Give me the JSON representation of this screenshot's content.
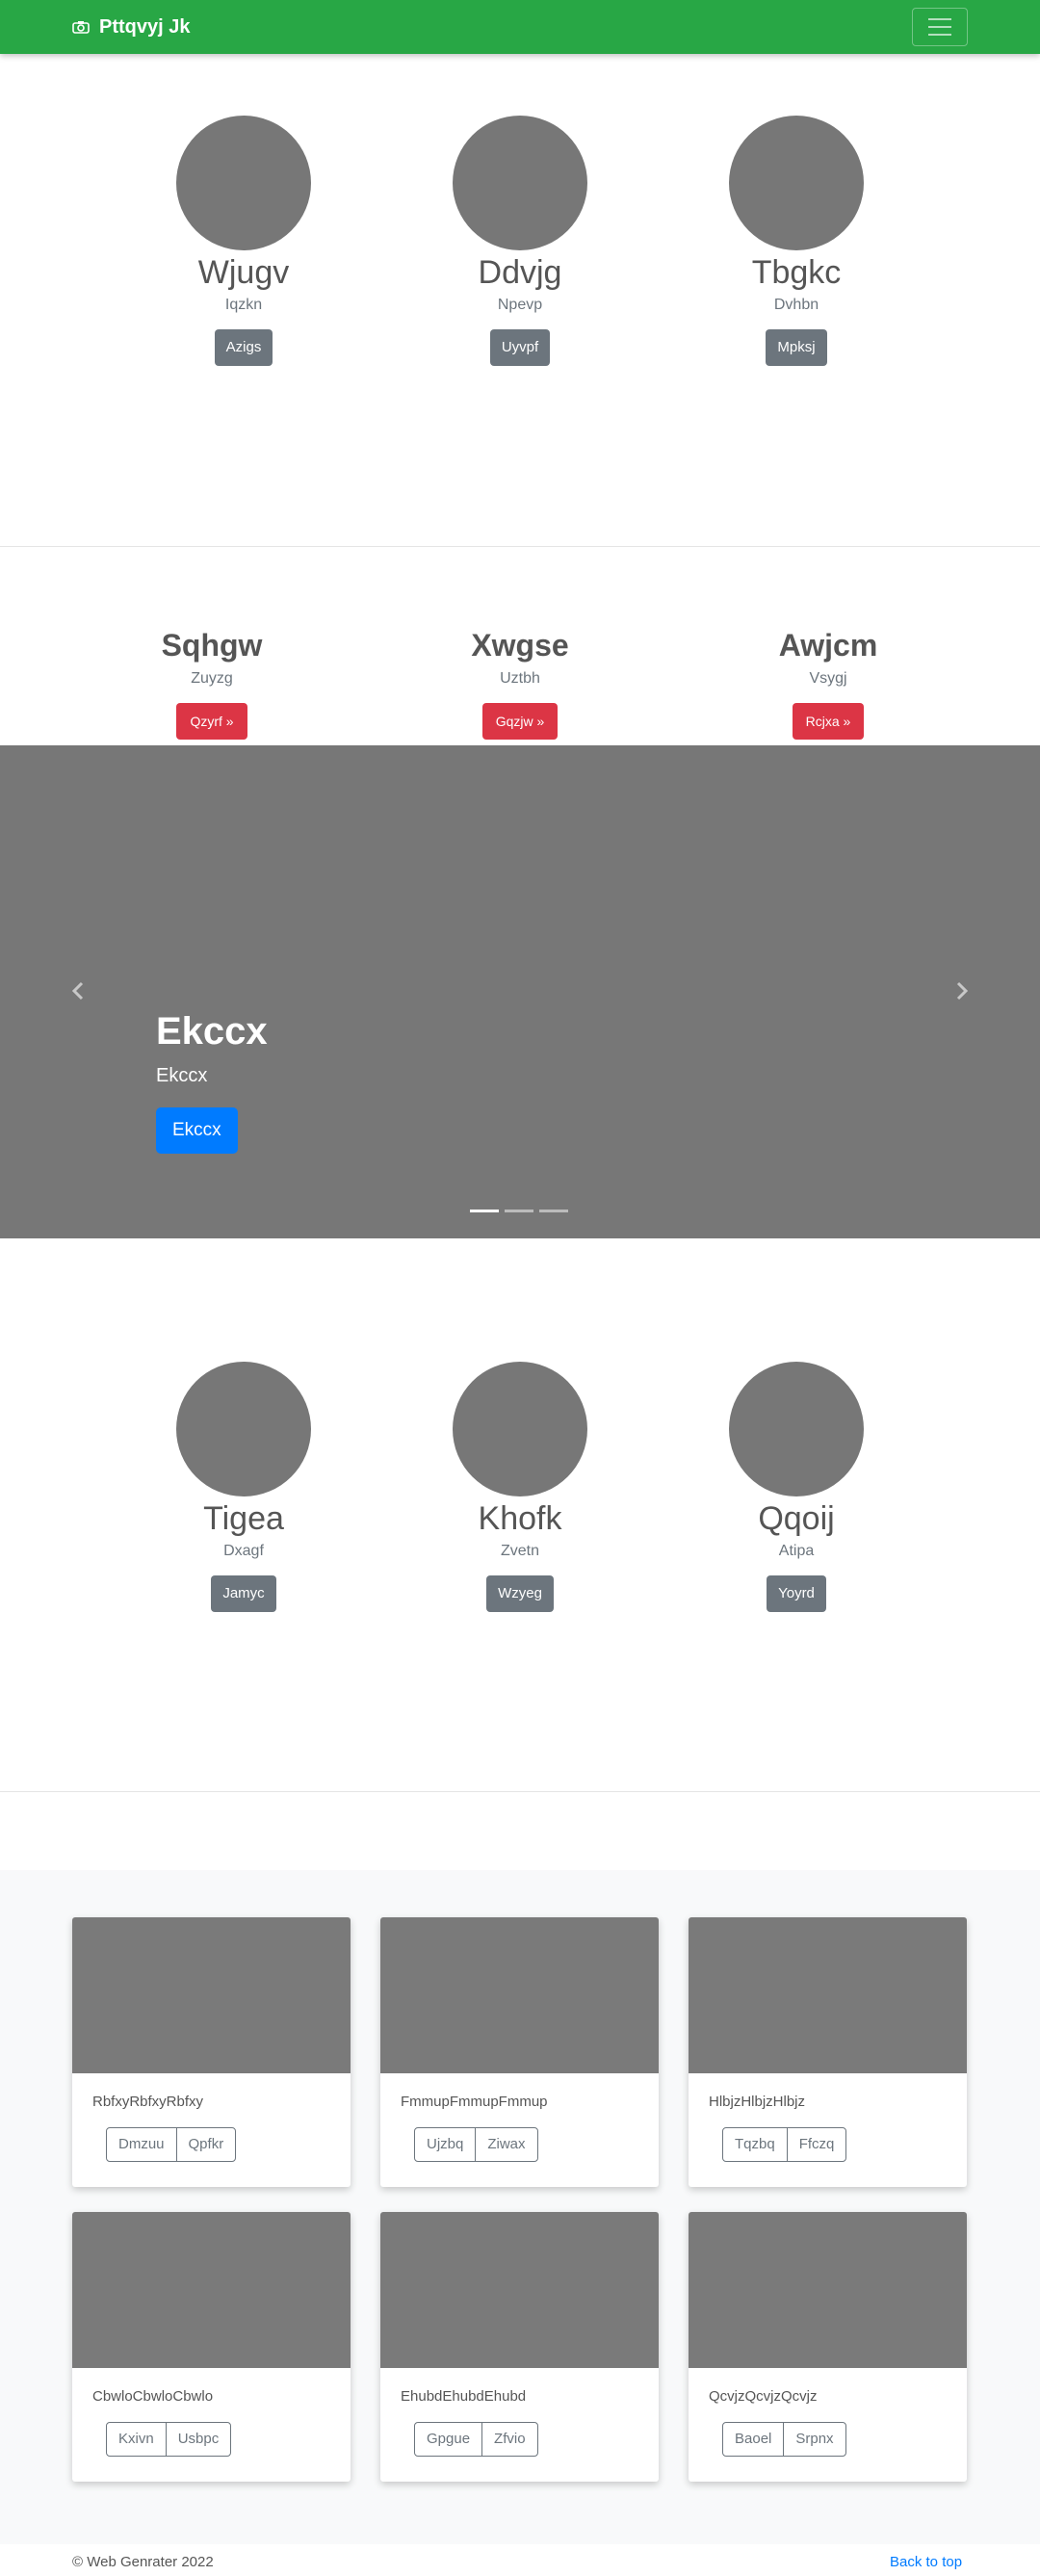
{
  "navbar": {
    "brand": "Pttqvyj Jk",
    "icons": {
      "brand": "camera-icon",
      "toggler": "hamburger-icon"
    }
  },
  "team_row_1": [
    {
      "name": "Wjugv",
      "role": "Iqzkn",
      "button": "Azigs"
    },
    {
      "name": "Ddvjg",
      "role": "Npevp",
      "button": "Uyvpf"
    },
    {
      "name": "Tbgkc",
      "role": "Dvhbn",
      "button": "Mpksj"
    }
  ],
  "features": [
    {
      "title": "Sqhgw",
      "subtitle": "Zuyzg",
      "button": "Qzyrf »"
    },
    {
      "title": "Xwgse",
      "subtitle": "Uztbh",
      "button": "Gqzjw »"
    },
    {
      "title": "Awjcm",
      "subtitle": "Vsygj",
      "button": "Rcjxa »"
    }
  ],
  "carousel": {
    "title": "Ekccx",
    "subtitle": "Ekccx",
    "button": "Ekccx",
    "slide_count": 3,
    "active_slide": 1,
    "icons": {
      "prev": "chevron-left-icon",
      "next": "chevron-right-icon"
    }
  },
  "team_row_2": [
    {
      "name": "Tigea",
      "role": "Dxagf",
      "button": "Jamyc"
    },
    {
      "name": "Khofk",
      "role": "Zvetn",
      "button": "Wzyeg"
    },
    {
      "name": "Qqoij",
      "role": "Atipa",
      "button": "Yoyrd"
    }
  ],
  "cards": [
    {
      "text": "RbfxyRbfxyRbfxy",
      "btn1": "Dmzuu",
      "btn2": "Qpfkr"
    },
    {
      "text": "FmmupFmmupFmmup",
      "btn1": "Ujzbq",
      "btn2": "Ziwax"
    },
    {
      "text": "HlbjzHlbjzHlbjz",
      "btn1": "Tqzbq",
      "btn2": "Ffczq"
    },
    {
      "text": "CbwloCbwloCbwlo",
      "btn1": "Kxivn",
      "btn2": "Usbpc"
    },
    {
      "text": "EhubdEhubdEhubd",
      "btn1": "Gpgue",
      "btn2": "Zfvio"
    },
    {
      "text": "QcvjzQcvjzQcvjz",
      "btn1": "Baoel",
      "btn2": "Srpnx"
    }
  ],
  "footer": {
    "copyright": "© Web Genrater 2022",
    "back_to_top": "Back to top"
  },
  "colors": {
    "navbar": "#28a745",
    "placeholder": "#777777",
    "primary": "#007bff",
    "danger": "#dc3545",
    "secondary": "#6c757d"
  }
}
